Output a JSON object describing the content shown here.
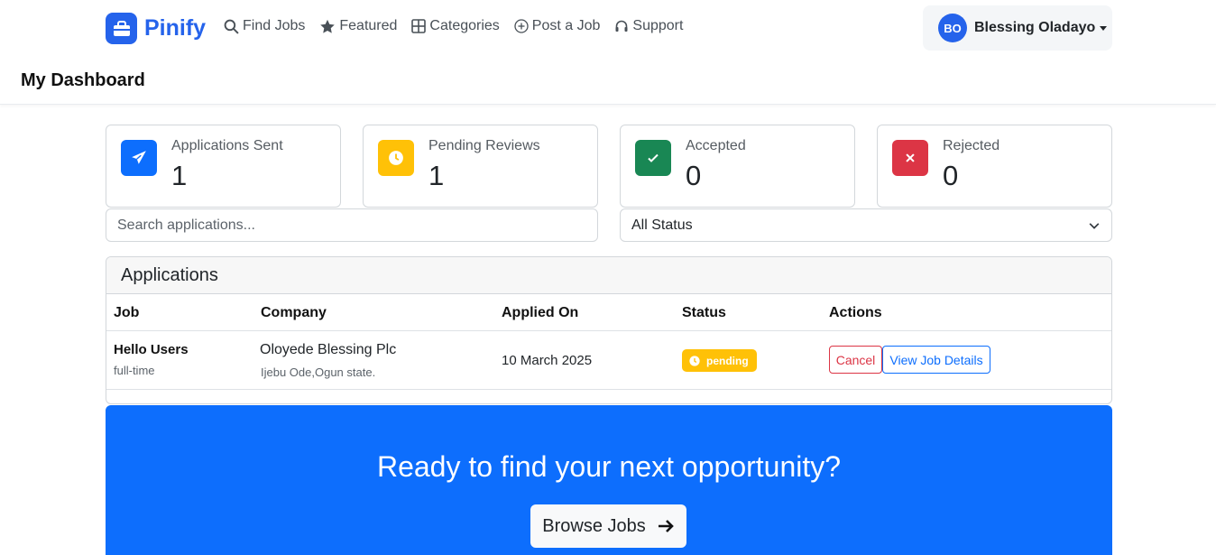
{
  "brand": {
    "name": "Pinify",
    "icon": "briefcase-icon",
    "color": "#2563eb"
  },
  "nav": {
    "links": [
      {
        "label": "Find Jobs",
        "icon": "search-icon"
      },
      {
        "label": "Featured",
        "icon": "star-icon"
      },
      {
        "label": "Categories",
        "icon": "grid-icon"
      },
      {
        "label": "Post a Job",
        "icon": "plus-circle-icon"
      },
      {
        "label": "Support",
        "icon": "headset-icon"
      }
    ]
  },
  "user": {
    "initials": "BO",
    "name": "Blessing Oladayo"
  },
  "page": {
    "title": "My Dashboard"
  },
  "stats": [
    {
      "label": "Applications Sent",
      "value": "1",
      "icon": "paper-plane-icon",
      "color": "#0d6efd"
    },
    {
      "label": "Pending Reviews",
      "value": "1",
      "icon": "clock-icon",
      "color": "#ffc107"
    },
    {
      "label": "Accepted",
      "value": "0",
      "icon": "check-icon",
      "color": "#198754"
    },
    {
      "label": "Rejected",
      "value": "0",
      "icon": "x-icon",
      "color": "#dc3545"
    }
  ],
  "filters": {
    "search_placeholder": "Search applications...",
    "status_selected": "All Status"
  },
  "applications": {
    "title": "Applications",
    "columns": [
      "Job",
      "Company",
      "Applied On",
      "Status",
      "Actions"
    ],
    "rows": [
      {
        "job": "Hello Users",
        "type": "full-time",
        "company": "Oloyede Blessing Plc",
        "location": "Ijebu Ode,Ogun state.",
        "applied_on": "10 March 2025",
        "status": "pending",
        "actions": {
          "cancel": "Cancel",
          "view": "View Job Details"
        }
      }
    ]
  },
  "cta": {
    "title": "Ready to find your next opportunity?",
    "button": "Browse Jobs",
    "color": "#0d6efd"
  }
}
